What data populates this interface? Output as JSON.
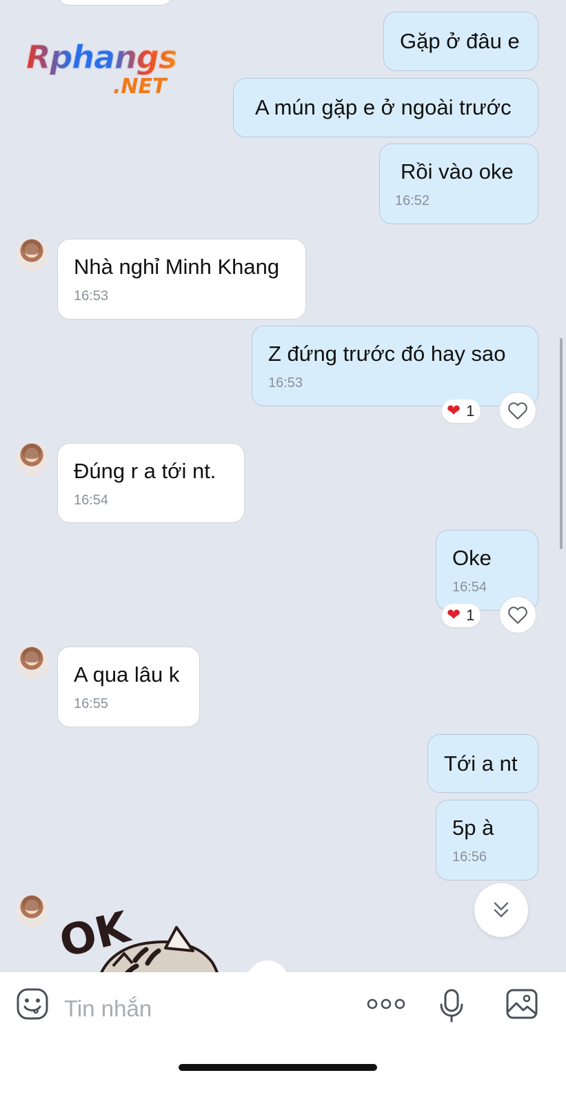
{
  "logo": {
    "top": "Rphangs",
    "bottom": ".NET"
  },
  "messages": [
    {
      "side": "out",
      "text": "Gặp ở đâu e",
      "time": ""
    },
    {
      "side": "out",
      "text": "A mún gặp e ở ngoài trước",
      "time": ""
    },
    {
      "side": "out",
      "text": "Rồi vào oke",
      "time": "16:52"
    },
    {
      "side": "in",
      "text": "Nhà nghỉ Minh Khang",
      "time": "16:53"
    },
    {
      "side": "out",
      "text": "Z đứng trước đó hay sao",
      "time": "16:53",
      "reaction": {
        "emoji": "heart",
        "count": "1"
      }
    },
    {
      "side": "in",
      "text": "Đúng r a tới nt.",
      "time": "16:54"
    },
    {
      "side": "out",
      "text": "Oke",
      "time": "16:54",
      "reaction": {
        "emoji": "heart",
        "count": "1"
      }
    },
    {
      "side": "in",
      "text": "A qua lâu k",
      "time": "16:55"
    },
    {
      "side": "out",
      "text": "Tới a nt",
      "time": ""
    },
    {
      "side": "out",
      "text": "5p à",
      "time": "16:56"
    }
  ],
  "sticker": {
    "text": "OK"
  },
  "composer": {
    "placeholder": "Tin nhắn"
  },
  "colors": {
    "background": "#e2e6ee",
    "outgoing_bubble": "#d8edfb",
    "incoming_bubble": "#ffffff",
    "heart": "#e0202a",
    "timestamp": "#8b9099"
  }
}
